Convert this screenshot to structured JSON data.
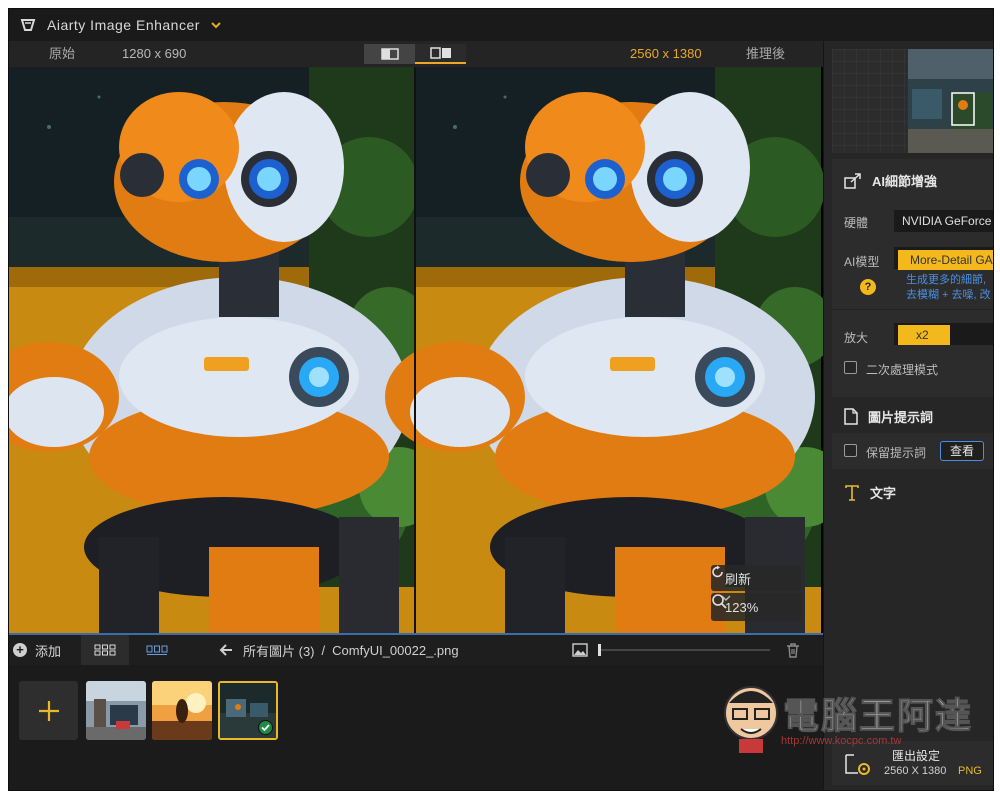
{
  "app": {
    "title": "Aiarty Image Enhancer"
  },
  "compare": {
    "left_tag": "原始",
    "left_resolution": "1280 x 690",
    "right_resolution": "2560 x 1380",
    "right_tag": "推理後"
  },
  "preview": {
    "refresh_label": "刷新",
    "zoom_level": "123%"
  },
  "toolbar": {
    "add_label": "添加",
    "breadcrumb_all": "所有圖片 (3)",
    "breadcrumb_sep": "/",
    "breadcrumb_file": "ComfyUI_00022_.png"
  },
  "panel": {
    "ai_section_title": "AI細節增強",
    "hardware_label": "硬體",
    "hardware_value": "NVIDIA GeForce RTX",
    "model_label": "AI模型",
    "model_value": "More-Detail GAN",
    "model_desc_line1": "生成更多的細節,",
    "model_desc_line2": "去模糊 + 去噪, 改",
    "scale_label": "放大",
    "scale_value": "x2",
    "second_pass_label": "二次處理模式",
    "prompt_section_title": "圖片提示詞",
    "keep_prompt_label": "保留提示詞",
    "view_button": "查看",
    "text_section_title": "文字"
  },
  "export": {
    "title": "匯出設定",
    "resolution": "2560 X 1380",
    "format": "PNG"
  },
  "watermark": {
    "text": "電腦王阿達",
    "url": "http://www.kocpc.com.tw"
  },
  "colors": {
    "accent": "#e9a82a",
    "pill": "#f2b81c",
    "link": "#4b8fe0",
    "check": "#1f8a45"
  }
}
